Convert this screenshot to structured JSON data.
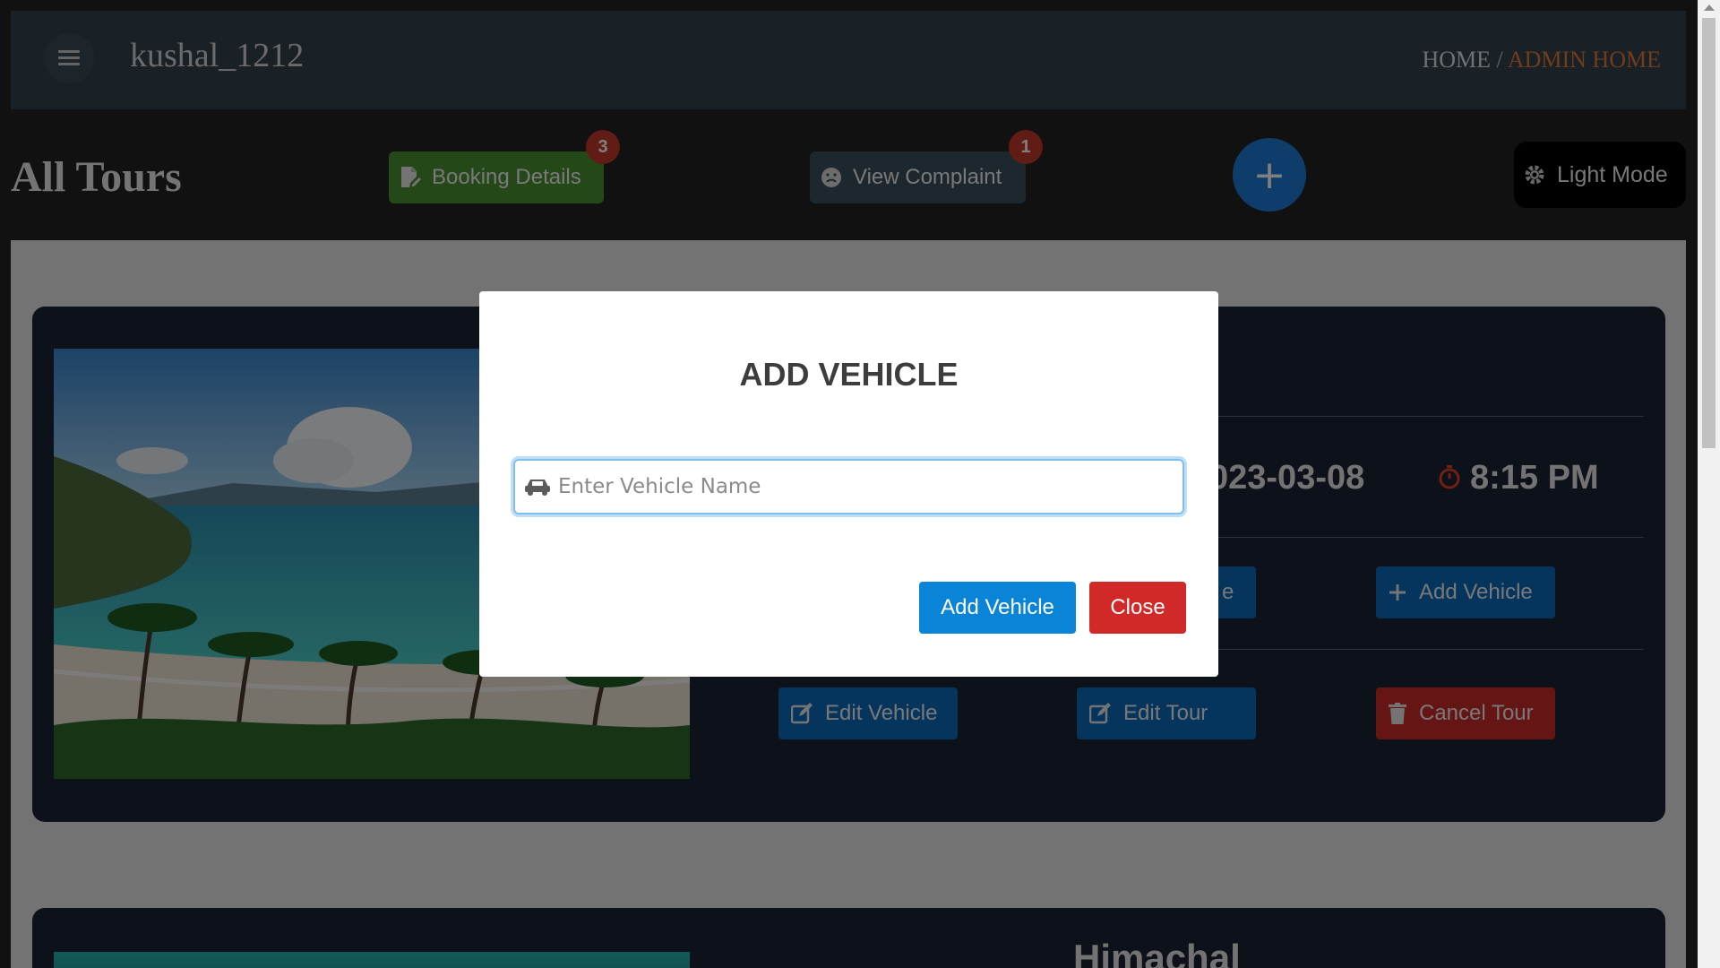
{
  "navbar": {
    "username": "kushal_1212",
    "breadcrumb": {
      "home": "HOME",
      "separator": " / ",
      "current": "ADMIN HOME"
    },
    "menu_icon": "hamburger-icon"
  },
  "header": {
    "title": "All Tours",
    "booking_label": "Booking Details",
    "booking_badge": "3",
    "complaint_label": "View Complaint",
    "complaint_badge": "1",
    "add_icon": "plus-icon",
    "add_symbol": "+",
    "theme_label": "Light Mode"
  },
  "tour_card": {
    "date": "023-03-08",
    "time": "8:15 PM",
    "partial_button": "e",
    "add_vehicle_label": "Add Vehicle",
    "edit_vehicle_label": "Edit Vehicle",
    "edit_tour_label": "Edit Tour",
    "cancel_tour_label": "Cancel Tour"
  },
  "tour_card_2": {
    "title": "Himachal"
  },
  "modal": {
    "title": "ADD VEHICLE",
    "input_placeholder": "Enter Vehicle Name",
    "input_value": "",
    "submit_label": "Add Vehicle",
    "close_label": "Close"
  },
  "colors": {
    "navbar": "#34434d",
    "accent_orange": "#e07b39",
    "booking_green": "#4a9130",
    "fab_blue": "#1e7bd6",
    "modal_add_blue": "#0a84d6",
    "modal_close_red": "#d12828",
    "card_bg": "#1b2335"
  }
}
